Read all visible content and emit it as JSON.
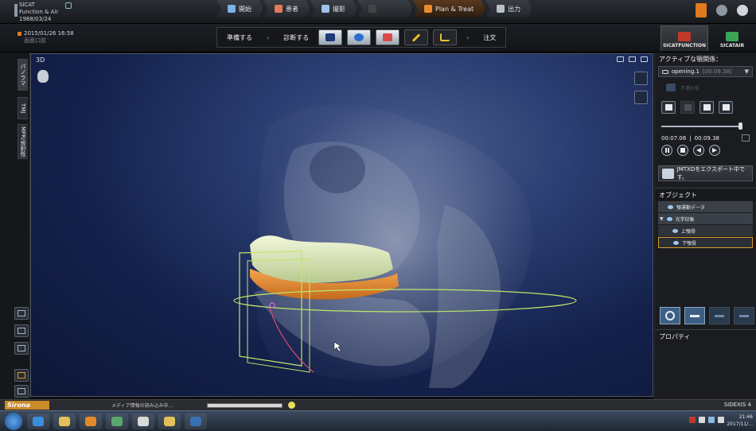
{
  "app": {
    "name_line1": "SICAT",
    "name_line2": "Function & Air",
    "dob": "1988/03/24"
  },
  "workflow_tabs": [
    {
      "label": "開始",
      "icon": "start-icon",
      "color": "#7ab3e8"
    },
    {
      "label": "患者",
      "icon": "patient-icon",
      "color": "#e27b5a"
    },
    {
      "label": "撮影",
      "icon": "camera-icon",
      "color": "#9ec3ea"
    },
    {
      "label": "",
      "icon": "unavailable-icon",
      "color": "#555555"
    },
    {
      "label": "Plan & Treat",
      "icon": "plan-icon",
      "color": "#e88b2e"
    },
    {
      "label": "出力",
      "icon": "output-icon",
      "color": "#b7c1cc"
    }
  ],
  "patient": {
    "date_time": "2015/01/26 16:58",
    "info": "画面口腔"
  },
  "steps": {
    "prepare": "準備する",
    "diagnose": "診断する",
    "order": "注文"
  },
  "modules": {
    "function": {
      "label_a": "SICAT",
      "label_b": "FUNCTION"
    },
    "air": {
      "label_a": "SICAT",
      "label_b": "AIR"
    }
  },
  "left_tabs": [
    "パノラマ",
    "TMJ",
    "MPR/放射性"
  ],
  "viewport": {
    "label": "3D"
  },
  "right_panel": {
    "active_relation_header": "アクティブな顎関係：",
    "dropdown_value": "opening.1",
    "dropdown_time": "[00:09.38]",
    "ghost_label": "不適の仮",
    "slider_position": 0.95,
    "time_current": "00:07.06",
    "time_sep": "|",
    "time_total": "00:09.38",
    "export_label": "JMTXDをエクスポート中です。",
    "objects_header": "オブジェクト",
    "objects": [
      {
        "label": "顎運動データ",
        "level": "top",
        "expander": ""
      },
      {
        "label": "光学印象",
        "level": "top",
        "expander": "▼"
      },
      {
        "label": "上顎骨",
        "level": "child",
        "expander": ""
      },
      {
        "label": "下顎骨",
        "level": "child",
        "expander": "",
        "selected": true
      }
    ],
    "properties_header": "プロパティ"
  },
  "status": {
    "brand": "Sirona",
    "progress_text": "メディア情報の読み込み中...",
    "progress_value": 1.0,
    "product": "SIDEXIS 4"
  },
  "taskbar": {
    "apps": [
      {
        "icon": "ie-icon",
        "color": "#3b8de0"
      },
      {
        "icon": "folder-icon",
        "color": "#e4c05a"
      },
      {
        "icon": "media-player-icon",
        "color": "#e28a2a"
      },
      {
        "icon": "app-icon",
        "color": "#59a86d"
      },
      {
        "icon": "chrome-icon",
        "color": "#d9d9d9"
      },
      {
        "icon": "folder-2-icon",
        "color": "#e4c05a"
      },
      {
        "icon": "sidexis-icon",
        "color": "#3a6fb5"
      }
    ],
    "clock_time": "21:46",
    "clock_date": "2017/11/..."
  }
}
